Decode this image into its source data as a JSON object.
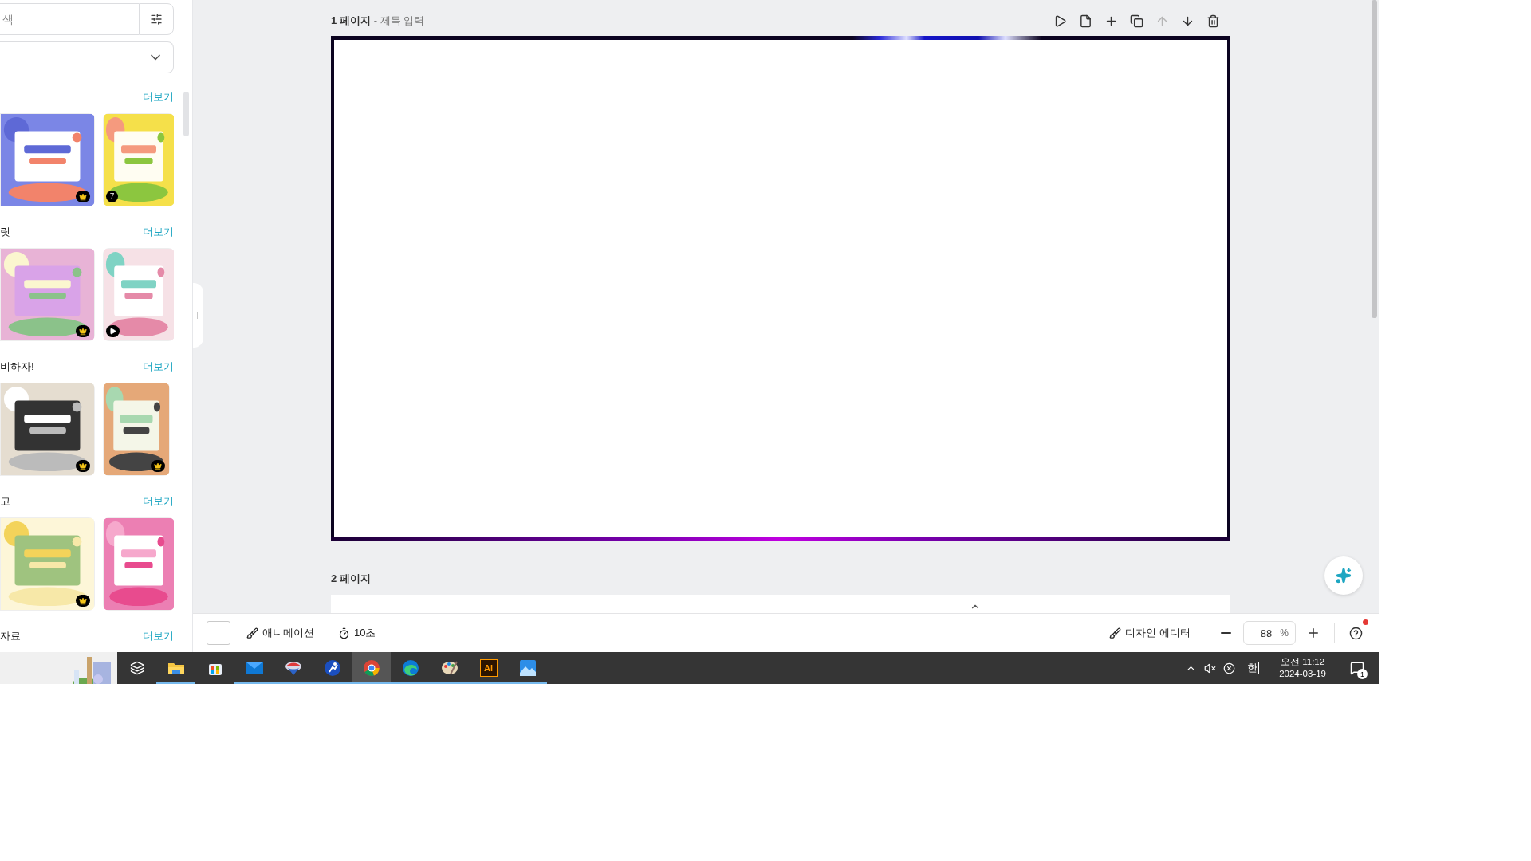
{
  "sidebar": {
    "search": {
      "placeholder": "색"
    },
    "sections": [
      {
        "more": "더보기",
        "thumbs": [
          {
            "kind": "crown"
          },
          {
            "kind": "count",
            "count": "7"
          }
        ]
      },
      {
        "title": "릿",
        "more": "더보기",
        "thumbs": [
          {
            "kind": "crown"
          },
          {
            "kind": "play"
          }
        ]
      },
      {
        "title": "비하자!",
        "more": "더보기",
        "thumbs": [
          {
            "kind": "crown"
          },
          {
            "kind": "crown"
          }
        ]
      },
      {
        "title": "고",
        "more": "더보기",
        "thumbs": [
          {
            "kind": "crown"
          },
          {
            "kind": "plain"
          }
        ]
      },
      {
        "title": "자료",
        "more": "더보기"
      }
    ]
  },
  "editor": {
    "pages": [
      {
        "number": "1 페이지",
        "title": "- 제목 입력"
      },
      {
        "number": "2 페이지"
      }
    ],
    "page_tools": [
      {
        "disabled": false
      },
      {
        "disabled": false
      },
      {
        "disabled": false
      },
      {
        "disabled": false
      },
      {
        "disabled": true
      },
      {
        "disabled": false
      },
      {
        "disabled": false
      }
    ]
  },
  "bottom_bar": {
    "animation": "애니메이션",
    "duration": "10초",
    "design_editor": "디자인 에디터",
    "zoom": "88",
    "zoom_unit": "%",
    "help_notification": true
  },
  "taskbar": {
    "apps": [
      {
        "running": false,
        "active": false
      },
      {
        "running": true,
        "active": false
      },
      {
        "running": false,
        "active": false
      },
      {
        "running": true,
        "active": false
      },
      {
        "running": true,
        "active": false
      },
      {
        "running": true,
        "active": false
      },
      {
        "running": true,
        "active": true
      },
      {
        "running": true,
        "active": false
      },
      {
        "running": true,
        "active": false
      },
      {
        "label": "Ai",
        "running": true,
        "active": false
      },
      {
        "running": true,
        "active": false
      }
    ],
    "tray": {
      "ime": "한",
      "time": "오전 11:12",
      "date": "2024-03-19",
      "notifications": "1"
    }
  }
}
